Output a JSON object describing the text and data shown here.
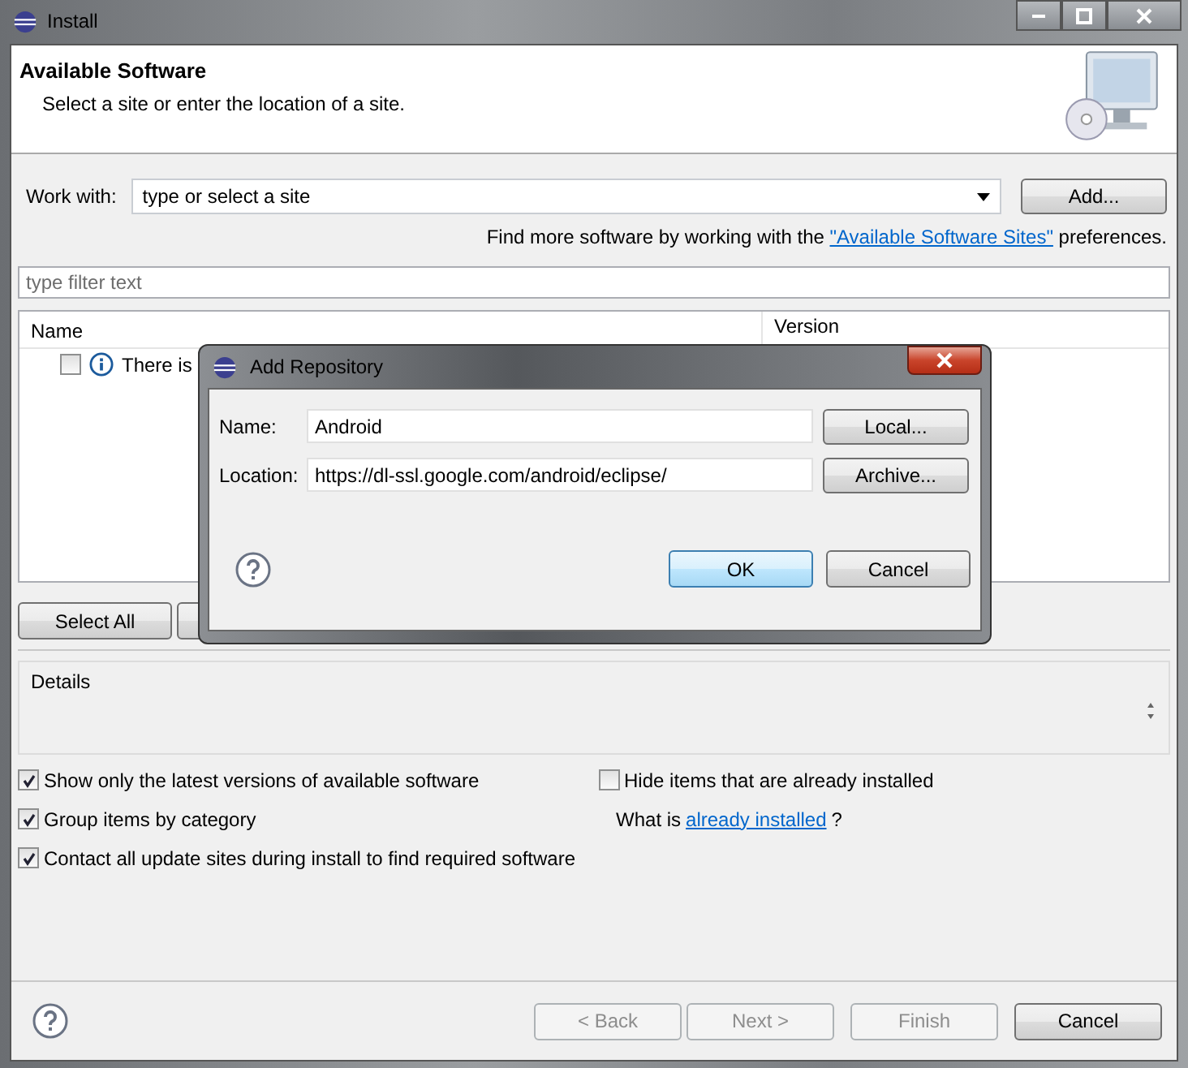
{
  "window": {
    "title": "Install"
  },
  "header": {
    "title": "Available Software",
    "description": "Select a site or enter the location of a site."
  },
  "work_with": {
    "label": "Work with:",
    "placeholder": "type or select a site",
    "button": "Add..."
  },
  "sites_note": {
    "prefix": "Find more software by working with the ",
    "link": "\"Available Software Sites\"",
    "suffix": " preferences."
  },
  "filter": {
    "placeholder": "type filter text"
  },
  "table": {
    "columns": [
      "Name",
      "Version"
    ],
    "rows": [
      {
        "checked": false,
        "text": "There is"
      }
    ]
  },
  "list_buttons": [
    "Select All"
  ],
  "details": {
    "label": "Details"
  },
  "options_left": [
    {
      "label": "Show only the latest versions of available software",
      "checked": true
    },
    {
      "label": "Group items by category",
      "checked": true
    },
    {
      "label": "Contact all update sites during install to find required software",
      "checked": true
    }
  ],
  "options_right": {
    "label": "Hide items that are already installed",
    "checked": false
  },
  "installed_note": {
    "prefix": "What is ",
    "link": "already installed",
    "suffix": "?"
  },
  "footer_buttons": [
    {
      "label": "< Back",
      "disabled": true
    },
    {
      "label": "Next >",
      "disabled": true
    },
    {
      "label": "Finish",
      "disabled": true
    },
    {
      "label": "Cancel",
      "disabled": false
    }
  ],
  "dialog": {
    "title": "Add Repository",
    "fields": [
      {
        "label": "Name:",
        "value": "Android",
        "button": "Local..."
      },
      {
        "label": "Location:",
        "value": "https://dl-ssl.google.com/android/eclipse/",
        "button": "Archive..."
      }
    ],
    "buttons": [
      {
        "label": "OK",
        "default": true
      },
      {
        "label": "Cancel",
        "default": false
      }
    ]
  }
}
